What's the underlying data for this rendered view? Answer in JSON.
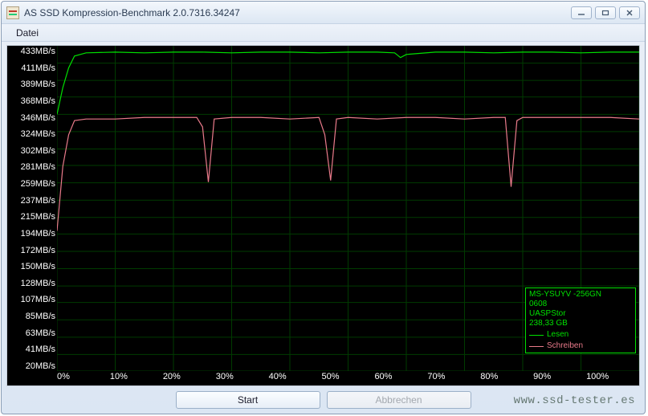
{
  "window": {
    "title": "AS SSD Kompression-Benchmark 2.0.7316.34247",
    "menu": {
      "datei": "Datei"
    },
    "buttons": {
      "start": "Start",
      "cancel": "Abbrechen"
    }
  },
  "watermark": "www.ssd-tester.es",
  "legend": {
    "device": "MS-YSUYV -256GN",
    "fw": "0608",
    "driver": "UASPStor",
    "size": "238,33 GB",
    "read_label": "Lesen",
    "write_label": "Schreiben",
    "read_color": "#00e000",
    "write_color": "#e97a8a"
  },
  "chart_data": {
    "type": "line",
    "xlabel": "",
    "ylabel": "",
    "x_unit": "%",
    "y_unit": "MB/s",
    "xlim": [
      0,
      100
    ],
    "ylim": [
      20,
      433
    ],
    "y_ticks": [
      433,
      411,
      389,
      368,
      346,
      324,
      302,
      281,
      259,
      237,
      215,
      194,
      172,
      150,
      128,
      107,
      85,
      63,
      41,
      20
    ],
    "x_ticks": [
      0,
      10,
      20,
      30,
      40,
      50,
      60,
      70,
      80,
      90,
      100
    ],
    "series": [
      {
        "name": "Lesen",
        "color": "#00e000",
        "x": [
          0,
          1,
          2,
          3,
          5,
          10,
          15,
          20,
          25,
          30,
          35,
          40,
          45,
          50,
          55,
          58,
          59,
          60,
          65,
          70,
          75,
          80,
          85,
          90,
          95,
          100
        ],
        "values": [
          346,
          380,
          405,
          420,
          424,
          425,
          424,
          425,
          425,
          424,
          425,
          425,
          424,
          425,
          425,
          424,
          418,
          422,
          425,
          425,
          424,
          425,
          425,
          424,
          425,
          425
        ]
      },
      {
        "name": "Schreiben",
        "color": "#e97a8a",
        "x": [
          0,
          1,
          2,
          3,
          5,
          10,
          15,
          20,
          24,
          25,
          26,
          27,
          30,
          35,
          40,
          45,
          46,
          47,
          48,
          50,
          55,
          60,
          65,
          70,
          75,
          77,
          78,
          79,
          80,
          85,
          90,
          95,
          100
        ],
        "values": [
          198,
          280,
          320,
          338,
          340,
          340,
          342,
          342,
          342,
          330,
          260,
          340,
          342,
          342,
          340,
          342,
          320,
          262,
          340,
          342,
          340,
          342,
          342,
          340,
          342,
          342,
          254,
          338,
          342,
          342,
          342,
          342,
          340
        ]
      }
    ]
  }
}
